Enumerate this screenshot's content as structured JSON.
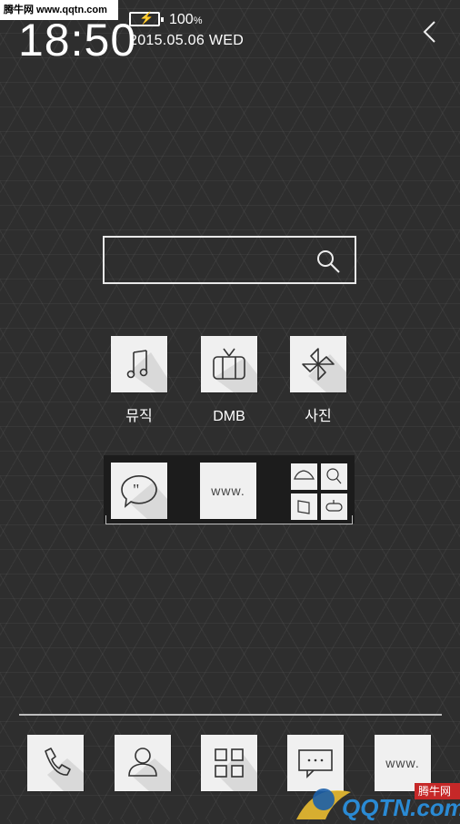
{
  "status": {
    "watermark": "腾牛网 www.qqtn.com",
    "time": "18:50",
    "battery_percent": "100",
    "battery_unit": "%",
    "date": "2015.05.06  WED"
  },
  "apps": [
    {
      "label": "뮤직",
      "icon": "music-note-icon"
    },
    {
      "label": "DMB",
      "icon": "tv-icon"
    },
    {
      "label": "사진",
      "icon": "pinwheel-icon"
    }
  ],
  "folder": {
    "items": [
      "quote-chat-icon",
      "www-browser-icon"
    ],
    "browser_text": "www.",
    "mini_icons": [
      "cloud-icon",
      "search-person-icon",
      "memo-icon",
      "gamepad-icon"
    ]
  },
  "dock": {
    "items": [
      "phone-icon",
      "contacts-icon",
      "apps-grid-icon",
      "messages-icon",
      "browser-icon"
    ],
    "browser_text": "www."
  },
  "watermark_bottom": {
    "brand": "腾牛网",
    "site": "QQTN.com"
  }
}
